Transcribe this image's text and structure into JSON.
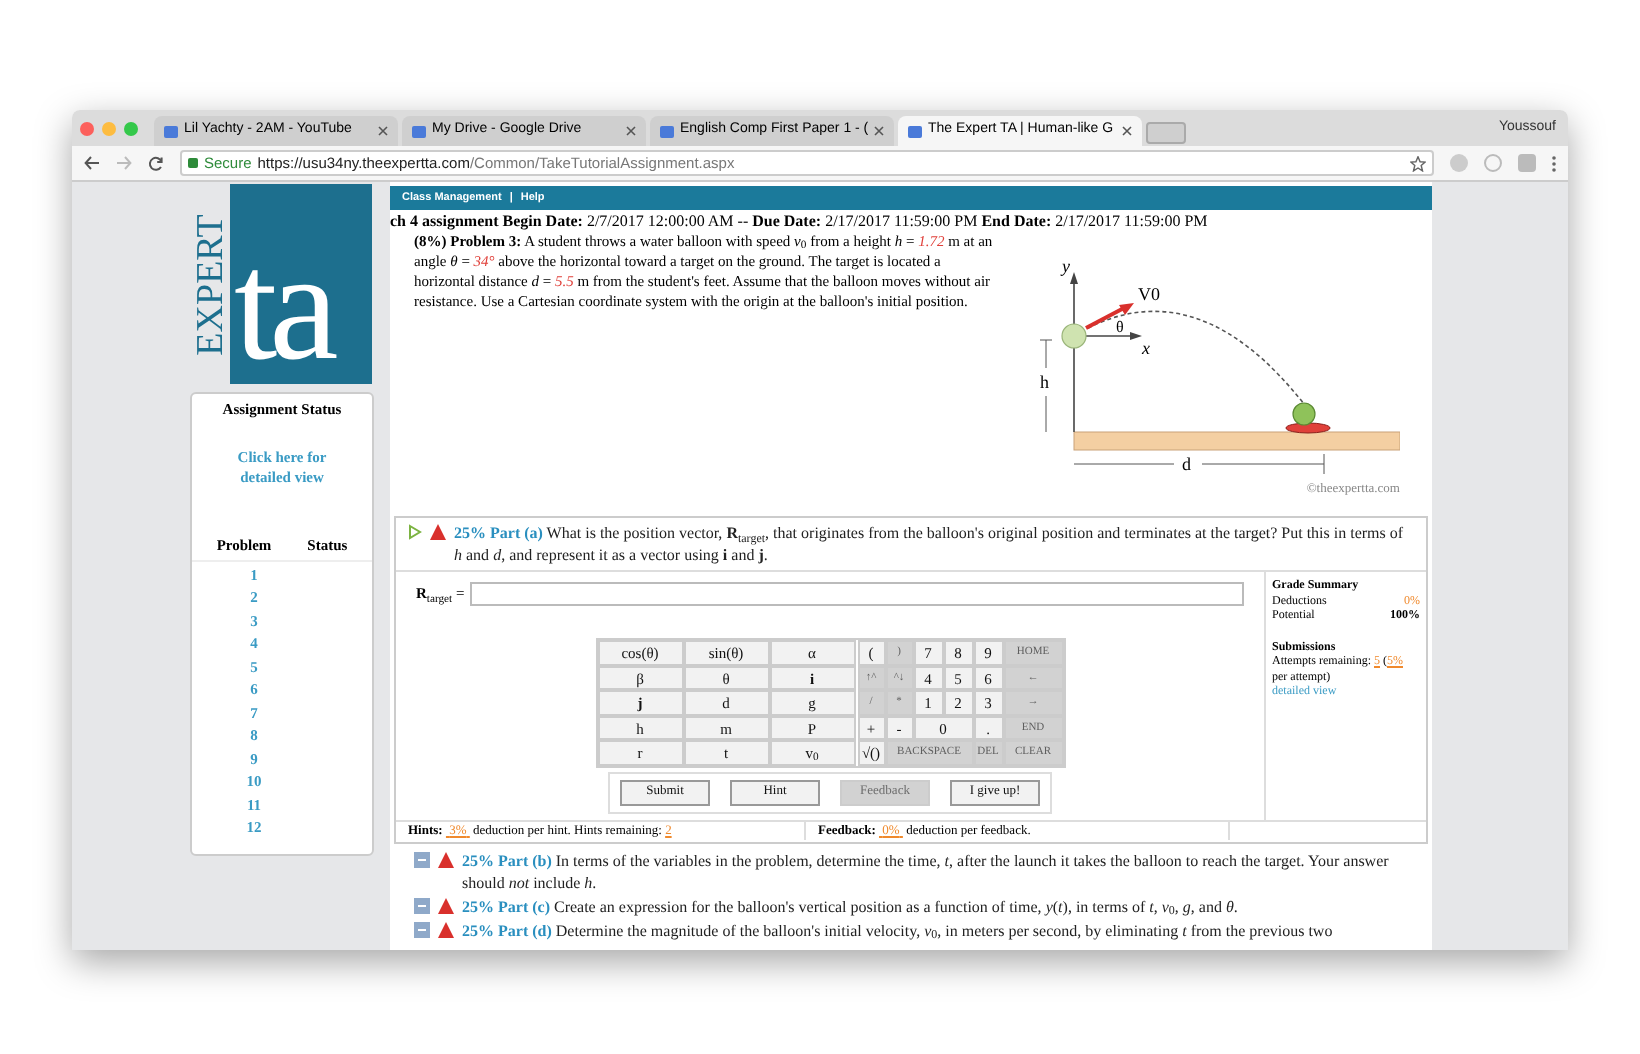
{
  "browser": {
    "tabs": [
      {
        "label": "Lil Yachty - 2AM - YouTube",
        "selected": false
      },
      {
        "label": "My Drive - Google Drive",
        "selected": false
      },
      {
        "label": "English Comp First Paper 1 - (",
        "selected": false
      },
      {
        "label": "The Expert TA | Human-like G",
        "selected": true
      }
    ],
    "profile": "Youssouf",
    "secure": "Secure",
    "url_host": "https://usu34ny.theexpertta.com",
    "url_path": "/Common/TakeTutorialAssignment.aspx"
  },
  "logo": {
    "vertical": "EXPERT",
    "letters": "ta"
  },
  "sidebar": {
    "title": "Assignment Status",
    "link": "Click here for detailed view",
    "columns": [
      "Problem",
      "Status"
    ],
    "problems": [
      "1",
      "2",
      "3",
      "4",
      "5",
      "6",
      "7",
      "8",
      "9",
      "10",
      "11",
      "12"
    ]
  },
  "nav": [
    "Class Management",
    "|",
    "Help"
  ],
  "dates": "**ch 4 assignment Begin Date:** 2/7/2017 12:00:00 AM -- **Due Date:** 2/17/2017 11:59:00 PM **End Date:** 2/17/2017 11:59:00 PM",
  "problem": {
    "label": "(8%) Problem 3:",
    "segments": [
      {
        "kind": "text",
        "text": " A student throws a water balloon with speed *v*$_{0}$ from a height *h* = "
      },
      {
        "kind": "value",
        "text": "1.72"
      },
      {
        "kind": "text",
        "text": " m at an angle *θ* = "
      },
      {
        "kind": "value",
        "text": "34°"
      },
      {
        "kind": "text",
        "text": " above the horizontal toward a target on the ground. The target is located a horizontal distance *d* = "
      },
      {
        "kind": "value",
        "text": "5.5"
      },
      {
        "kind": "text",
        "text": " m from the student's feet. Assume that the balloon moves without air resistance. Use a Cartesian coordinate system with the origin at the balloon's initial position."
      }
    ]
  },
  "diagram": {
    "labels": [
      "y",
      "V0",
      "θ",
      "x",
      "h",
      "d"
    ],
    "credit": "©theexpertta.com"
  },
  "part_a": {
    "weight": "25%",
    "name": "Part (a)",
    "expanded": true,
    "question": "What is the position vector, **R**$_{target}$, that originates from the balloon's original position and terminates at the target? Put this in terms of *h* and *d*, and represent it as a vector using **i** and **j**.",
    "input_label": "**R**$_{target}$ =",
    "keypad_left": [
      {
        "label": "cos(θ)",
        "disabled": false
      },
      {
        "label": "sin(θ)",
        "disabled": false
      },
      {
        "label": "α",
        "disabled": false
      },
      {
        "label": "β",
        "disabled": false
      },
      {
        "label": "θ",
        "disabled": false
      },
      {
        "label": "**i**",
        "disabled": false
      },
      {
        "label": "**j**",
        "disabled": false
      },
      {
        "label": "d",
        "disabled": false
      },
      {
        "label": "g",
        "disabled": false
      },
      {
        "label": "h",
        "disabled": false
      },
      {
        "label": "m",
        "disabled": false
      },
      {
        "label": "P",
        "disabled": false
      },
      {
        "label": "r",
        "disabled": false
      },
      {
        "label": "t",
        "disabled": false
      },
      {
        "label": "v$_{0}$",
        "disabled": false
      }
    ],
    "keypad_right": [
      {
        "label": "(",
        "disabled": false
      },
      {
        "label": ")",
        "disabled": true
      },
      {
        "label": "7",
        "disabled": false
      },
      {
        "label": "8",
        "disabled": false
      },
      {
        "label": "9",
        "disabled": false
      },
      {
        "label": "HOME",
        "disabled": true
      },
      {
        "label": "↑^",
        "disabled": true
      },
      {
        "label": "^↓",
        "disabled": true
      },
      {
        "label": "4",
        "disabled": false
      },
      {
        "label": "5",
        "disabled": false
      },
      {
        "label": "6",
        "disabled": false
      },
      {
        "label": "←",
        "disabled": true
      },
      {
        "label": "/",
        "disabled": true
      },
      {
        "label": "*",
        "disabled": true
      },
      {
        "label": "1",
        "disabled": false
      },
      {
        "label": "2",
        "disabled": false
      },
      {
        "label": "3",
        "disabled": false
      },
      {
        "label": "→",
        "disabled": true
      },
      {
        "label": "+",
        "disabled": false
      },
      {
        "label": "-",
        "disabled": false
      },
      {
        "label": "0",
        "disabled": false
      },
      {
        "label": ".",
        "disabled": false
      },
      {
        "label": "END",
        "disabled": true
      },
      {
        "label": "√()",
        "disabled": false
      },
      {
        "label": "BACKSPACE",
        "disabled": true
      },
      {
        "label": "DEL",
        "disabled": true
      },
      {
        "label": "CLEAR",
        "disabled": true
      }
    ],
    "buttons": [
      {
        "label": "Submit",
        "disabled": false
      },
      {
        "label": "Hint",
        "disabled": false
      },
      {
        "label": "Feedback",
        "disabled": true
      },
      {
        "label": "I give up!",
        "disabled": false
      }
    ],
    "grade": {
      "title": "Grade Summary",
      "rows": [
        {
          "label": "Deductions",
          "value": "0%",
          "kind": "accent"
        },
        {
          "label": "Potential",
          "value": "100%",
          "kind": "plain"
        }
      ]
    },
    "submissions": {
      "title": "Submissions",
      "attempts_label": "Attempts remaining:",
      "attempts": "5",
      "per_value": "5%",
      "per_label": "per attempt)",
      "open": "(",
      "link": "detailed view"
    },
    "hints": {
      "label": "Hints:",
      "value": "3%",
      "text": "deduction per hint. Hints remaining:",
      "remaining": "2"
    },
    "feedback": {
      "label": "Feedback:",
      "value": "0%",
      "text": "deduction per feedback."
    }
  },
  "other_parts": [
    {
      "weight": "25%",
      "name": "Part (b)",
      "expanded": false,
      "question": "In terms of the variables in the problem, determine the time, *t*, after the launch it takes the balloon to reach the target. Your answer should *not* include *h*."
    },
    {
      "weight": "25%",
      "name": "Part (c)",
      "expanded": false,
      "question": "Create an expression for the balloon's vertical position as a function of time, *y*(*t*), in terms of *t*, *v*$_{0}$, *g*, and *θ*."
    },
    {
      "weight": "25%",
      "name": "Part (d)",
      "expanded": false,
      "question": "Determine the magnitude of the balloon's initial velocity, *v*$_{0}$, in meters per second, by eliminating *t* from the previous two"
    }
  ]
}
